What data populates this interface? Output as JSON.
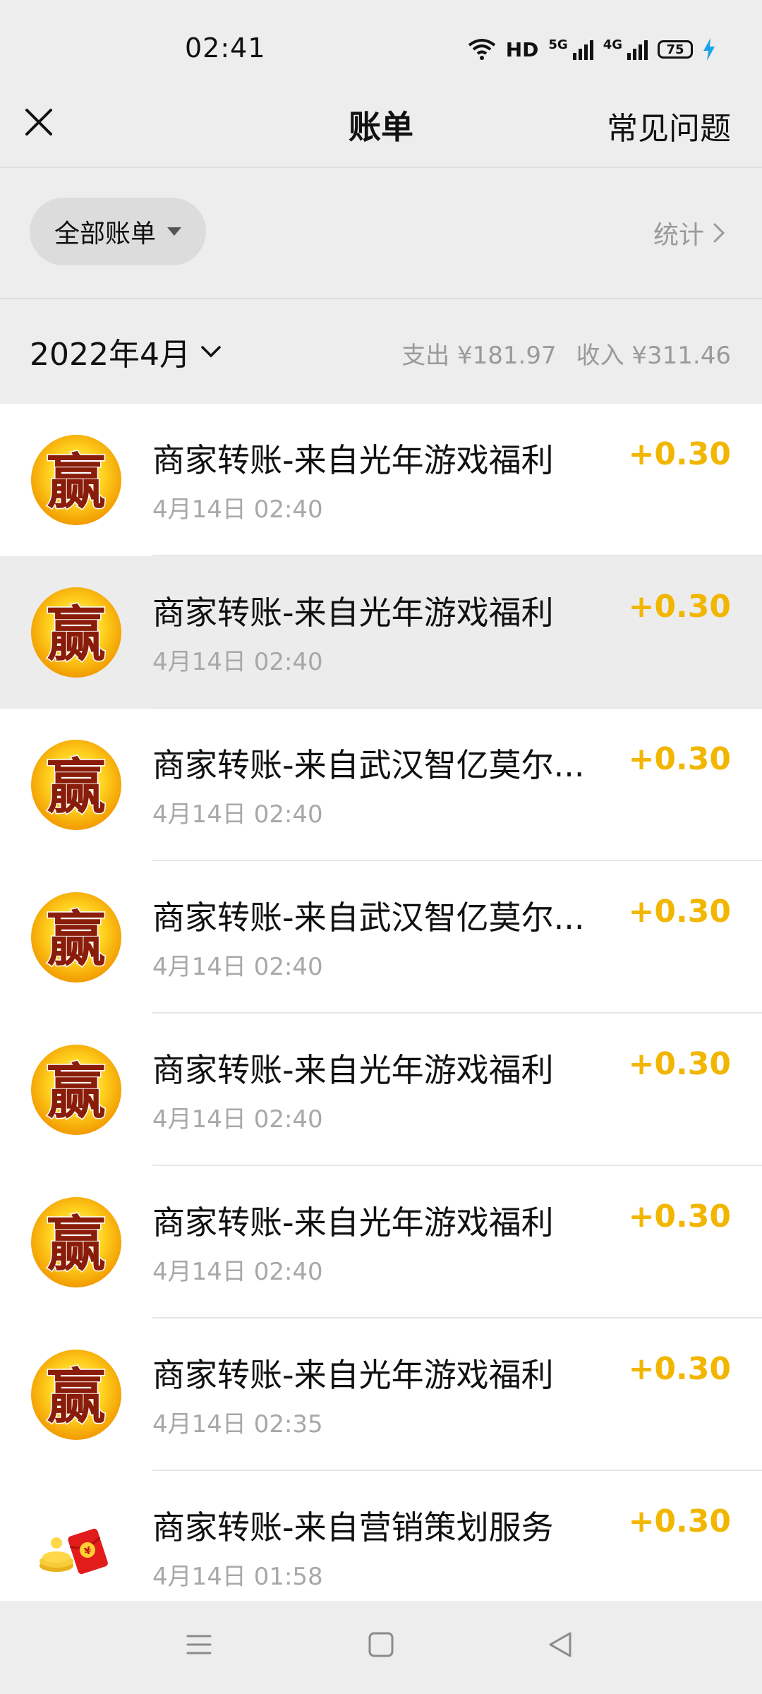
{
  "status_bar": {
    "time": "02:41",
    "hd": "HD",
    "net_5g": "5G",
    "net_4g": "4G",
    "battery": "75"
  },
  "header": {
    "title": "账单",
    "faq": "常见问题"
  },
  "filter": {
    "label": "全部账单",
    "stats": "统计"
  },
  "month": {
    "label": "2022年4月",
    "expense": "支出 ¥181.97",
    "income": "收入 ¥311.46"
  },
  "colors": {
    "amount": "#f2b600",
    "background": "#ededed"
  },
  "bills": [
    {
      "title": "商家转账-来自光年游戏福利",
      "time": "4月14日 02:40",
      "amount": "+0.30",
      "icon": "win-icon"
    },
    {
      "title": "商家转账-来自光年游戏福利",
      "time": "4月14日 02:40",
      "amount": "+0.30",
      "icon": "win-icon"
    },
    {
      "title": "商家转账-来自武汉智亿莫尔...",
      "time": "4月14日 02:40",
      "amount": "+0.30",
      "icon": "win-icon"
    },
    {
      "title": "商家转账-来自武汉智亿莫尔...",
      "time": "4月14日 02:40",
      "amount": "+0.30",
      "icon": "win-icon"
    },
    {
      "title": "商家转账-来自光年游戏福利",
      "time": "4月14日 02:40",
      "amount": "+0.30",
      "icon": "win-icon"
    },
    {
      "title": "商家转账-来自光年游戏福利",
      "time": "4月14日 02:40",
      "amount": "+0.30",
      "icon": "win-icon"
    },
    {
      "title": "商家转账-来自光年游戏福利",
      "time": "4月14日 02:35",
      "amount": "+0.30",
      "icon": "win-icon"
    },
    {
      "title": "商家转账-来自营销策划服务",
      "time": "4月14日 01:58",
      "amount": "+0.30",
      "icon": "red-envelope-icon"
    }
  ]
}
